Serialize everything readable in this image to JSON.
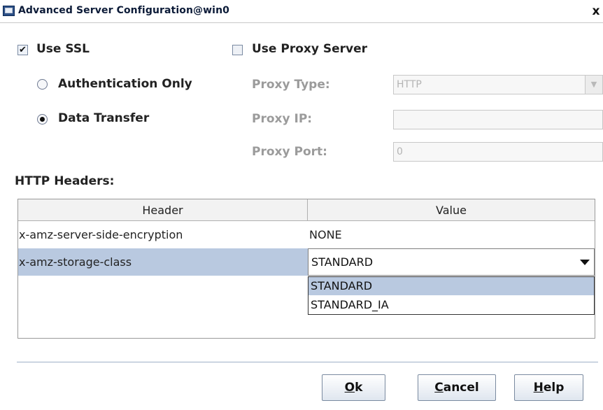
{
  "window": {
    "title": "Advanced Server Configuration@win0",
    "close_glyph": "x"
  },
  "ssl": {
    "checked": true,
    "label": "Use SSL",
    "options": [
      {
        "label": "Authentication Only",
        "selected": false
      },
      {
        "label": "Data Transfer",
        "selected": true
      }
    ]
  },
  "proxy": {
    "checked": false,
    "label": "Use Proxy Server",
    "type_label": "Proxy Type:",
    "type_value": "HTTP",
    "ip_label": "Proxy IP:",
    "ip_value": "",
    "port_label": "Proxy Port:",
    "port_value": "0"
  },
  "headers": {
    "section_label": "HTTP Headers:",
    "columns": [
      "Header",
      "Value"
    ],
    "rows": [
      {
        "header": "x-amz-server-side-encryption",
        "value": "NONE"
      },
      {
        "header": "x-amz-storage-class",
        "value": "STANDARD"
      }
    ],
    "dropdown_options": [
      "STANDARD",
      "STANDARD_IA"
    ],
    "dropdown_selected": "STANDARD"
  },
  "buttons": {
    "ok": {
      "label": "Ok",
      "mnemonic": "O",
      "rest": "k"
    },
    "cancel": {
      "label": "Cancel",
      "mnemonic": "C",
      "rest": "ancel"
    },
    "help": {
      "label": "Help",
      "mnemonic": "H",
      "rest": "elp"
    }
  },
  "colors": {
    "selection": "#b9c9e0",
    "title_text": "#0c1b38",
    "disabled_text": "#9b9b9b"
  }
}
